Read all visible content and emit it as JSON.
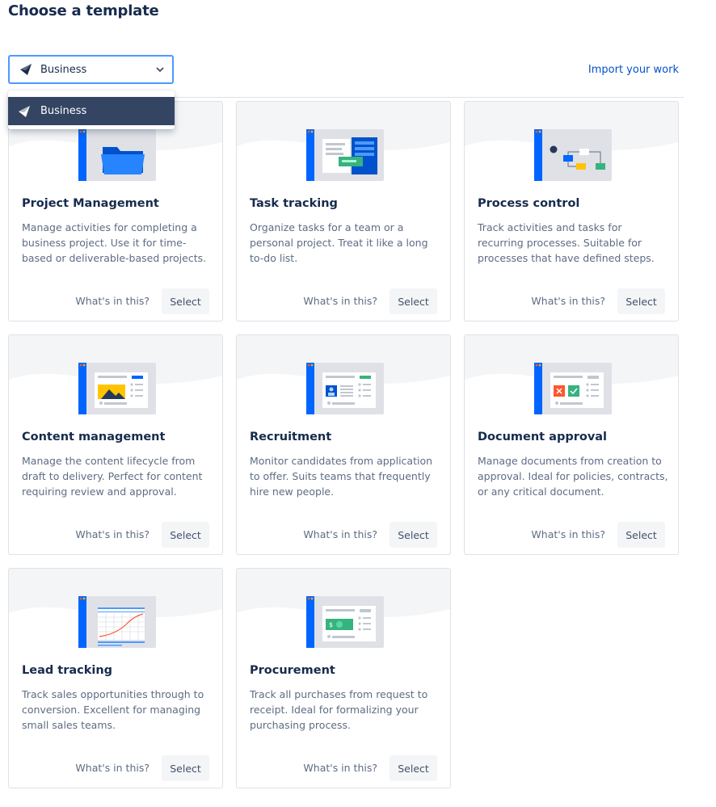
{
  "page_title": "Choose a template",
  "category_select": {
    "selected": "Business",
    "icon": "business-plane-icon"
  },
  "dropdown": {
    "items": [
      {
        "label": "Business",
        "icon": "business-plane-icon"
      }
    ]
  },
  "import_link": "Import your work",
  "colors": {
    "accent_blue": "#0052cc",
    "focus_border": "#4c9aff",
    "dropdown_selected": "#344563",
    "sidebar_blue": "#0065ff",
    "title_text": "#172b4d",
    "muted_text": "#5e6c84"
  },
  "cards": [
    {
      "title": "Project Management",
      "description": "Manage activities for completing a business project. Use it for time-based or deliverable-based projects.",
      "whats_label": "What's in this?",
      "select_label": "Select",
      "illustration": "folder-icon"
    },
    {
      "title": "Task tracking",
      "description": "Organize tasks for a team or a personal project. Treat it like a long to-do list.",
      "whats_label": "What's in this?",
      "select_label": "Select",
      "illustration": "task-board-icon"
    },
    {
      "title": "Process control",
      "description": "Track activities and tasks for recurring processes. Suitable for processes that have defined steps.",
      "whats_label": "What's in this?",
      "select_label": "Select",
      "illustration": "flowchart-icon"
    },
    {
      "title": "Content management",
      "description": "Manage the content lifecycle from draft to delivery. Perfect for content requiring review and approval.",
      "whats_label": "What's in this?",
      "select_label": "Select",
      "illustration": "content-image-icon"
    },
    {
      "title": "Recruitment",
      "description": "Monitor candidates from application to offer. Suits teams that frequently hire new people.",
      "whats_label": "What's in this?",
      "select_label": "Select",
      "illustration": "candidate-profile-icon"
    },
    {
      "title": "Document approval",
      "description": "Manage documents from creation to approval. Ideal for policies, contracts, or any critical document.",
      "whats_label": "What's in this?",
      "select_label": "Select",
      "illustration": "approval-icon"
    },
    {
      "title": "Lead tracking",
      "description": "Track sales opportunities through to conversion. Excellent for managing small sales teams.",
      "whats_label": "What's in this?",
      "select_label": "Select",
      "illustration": "sales-chart-icon"
    },
    {
      "title": "Procurement",
      "description": "Track all purchases from request to receipt. Ideal for formalizing your purchasing process.",
      "whats_label": "What's in this?",
      "select_label": "Select",
      "illustration": "money-bill-icon"
    }
  ]
}
